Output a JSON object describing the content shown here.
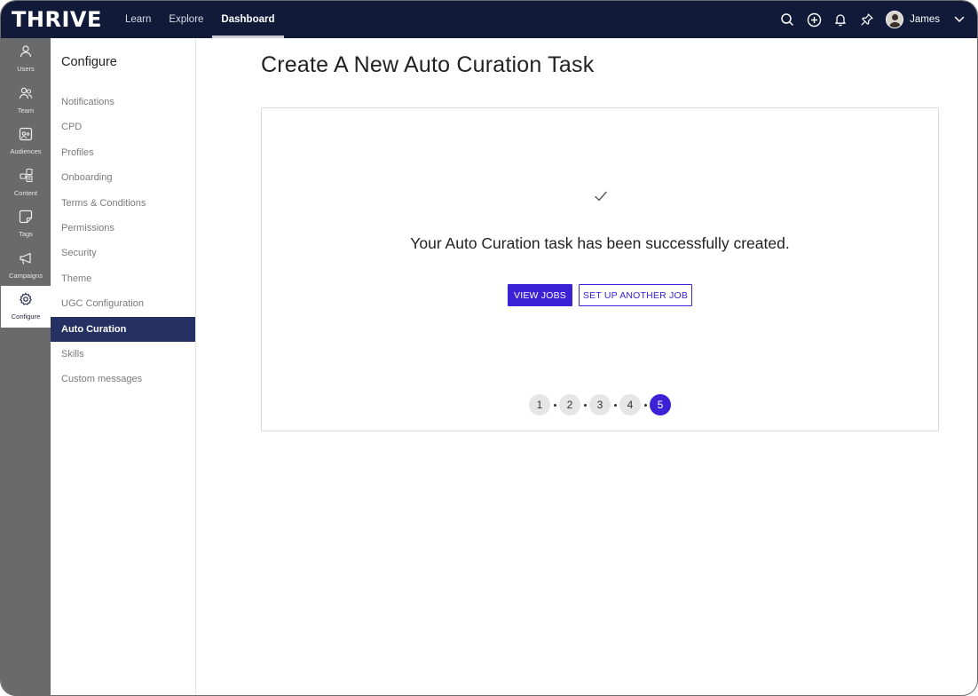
{
  "app": {
    "logo": "THRIVE"
  },
  "topnav": {
    "items": [
      {
        "label": "Learn"
      },
      {
        "label": "Explore"
      },
      {
        "label": "Dashboard",
        "active": true
      }
    ]
  },
  "topbar": {
    "icons": [
      "search-icon",
      "add-circle-icon",
      "bell-icon",
      "pin-icon"
    ],
    "user": {
      "name": "James"
    }
  },
  "rail": {
    "items": [
      {
        "label": "Users",
        "icon": "user-icon"
      },
      {
        "label": "Team",
        "icon": "team-icon"
      },
      {
        "label": "Audiences",
        "icon": "audiences-icon"
      },
      {
        "label": "Content",
        "icon": "content-icon"
      },
      {
        "label": "Tags",
        "icon": "tag-icon"
      },
      {
        "label": "Campaigns",
        "icon": "megaphone-icon"
      },
      {
        "label": "Configure",
        "icon": "gear-icon",
        "active": true
      }
    ]
  },
  "config": {
    "title": "Configure",
    "items": [
      {
        "label": "Notifications"
      },
      {
        "label": "CPD"
      },
      {
        "label": "Profiles"
      },
      {
        "label": "Onboarding"
      },
      {
        "label": "Terms & Conditions"
      },
      {
        "label": "Permissions"
      },
      {
        "label": "Security"
      },
      {
        "label": "Theme"
      },
      {
        "label": "UGC Configuration"
      },
      {
        "label": "Auto Curation",
        "active": true
      },
      {
        "label": "Skills"
      },
      {
        "label": "Custom messages"
      }
    ]
  },
  "main": {
    "title": "Create A New Auto Curation Task",
    "success_message": "Your Auto Curation task has been successfully created.",
    "primary_button": "VIEW JOBS",
    "secondary_button": "SET UP ANOTHER JOB",
    "steps": [
      "1",
      "2",
      "3",
      "4",
      "5"
    ],
    "current_step": 5
  },
  "colors": {
    "topbar": "#111a38",
    "accent": "#3b22d6",
    "rail": "#6a6a6a",
    "active_sidebar": "#253063"
  }
}
